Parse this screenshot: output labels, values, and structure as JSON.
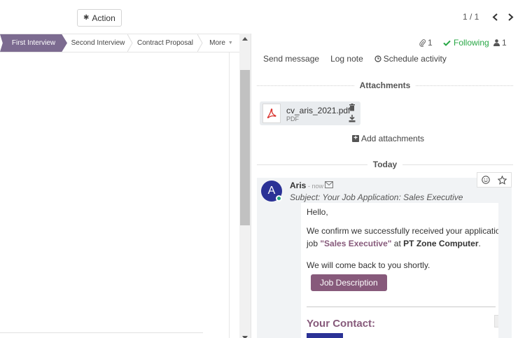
{
  "toolbar": {
    "action_label": "Action"
  },
  "pager": {
    "value": "1 / 1"
  },
  "statusbar": {
    "stages": [
      "First Interview",
      "Second Interview",
      "Contract Proposal"
    ],
    "more_label": "More"
  },
  "chatter": {
    "attachment_count": "1",
    "following_label": "Following",
    "follower_count": "1",
    "send_message": "Send message",
    "log_note": "Log note",
    "schedule_activity": "Schedule activity",
    "attachments_heading": "Attachments",
    "attachment": {
      "name": "cv_aris_2021.pdf",
      "type": "PDF"
    },
    "add_attachments": "Add attachments",
    "today_label": "Today",
    "message": {
      "avatar_letter": "A",
      "author": "Aris",
      "date": "- now",
      "subject": "Subject: Your Job Application: Sales Executive",
      "greeting": "Hello,",
      "line1": "We confirm we successfully received your application for th",
      "line2_prefix": "job ",
      "job_title": "\"Sales Executive\"",
      "line2_mid": " at ",
      "company": "PT Zone Computer",
      "line2_suffix": ".",
      "line3": "We will come back to you shortly.",
      "job_button": "Job Description",
      "contact_title": "Your Contact:"
    }
  },
  "colors": {
    "accent": "#875a7b",
    "stage_active": "#7c6b90",
    "following": "#28a745",
    "avatar": "#2b3296"
  }
}
